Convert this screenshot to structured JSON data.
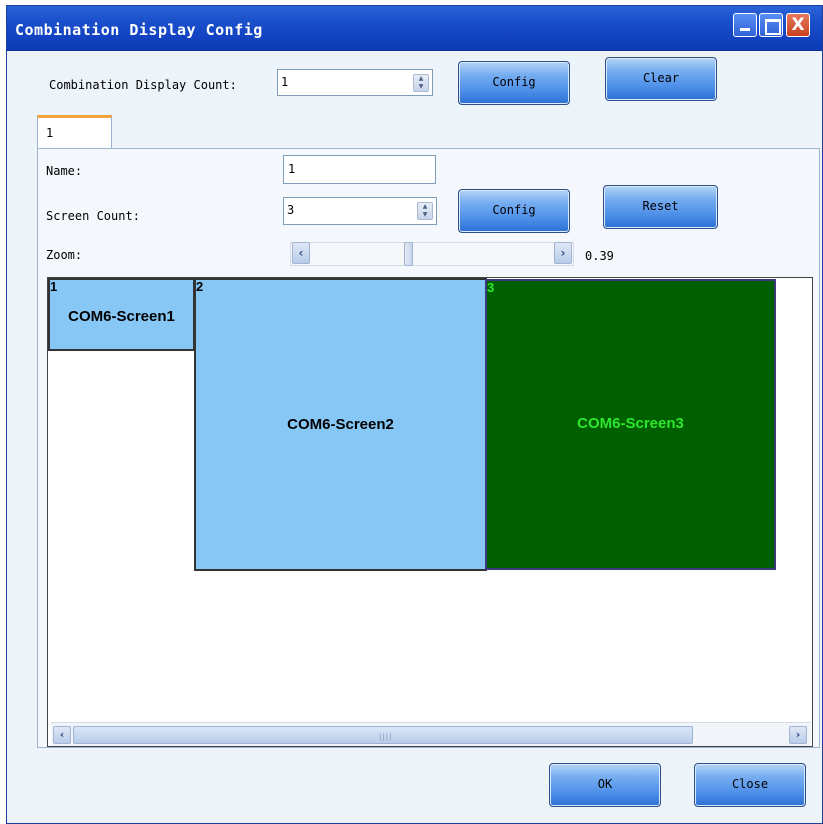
{
  "window": {
    "title": "Combination Display Config",
    "close_glyph": "X"
  },
  "top": {
    "count_label": "Combination Display Count:",
    "count_value": "1",
    "config_label": "Config",
    "clear_label": "Clear"
  },
  "tab": {
    "label": "1"
  },
  "form": {
    "name_label": "Name:",
    "name_value": "1",
    "screen_count_label": "Screen Count:",
    "screen_count_value": "3",
    "config_label": "Config",
    "reset_label": "Reset",
    "zoom_label": "Zoom:",
    "zoom_value": "0.39"
  },
  "screens": [
    {
      "num": "1",
      "name": "COM6-Screen1",
      "fill": "#87c7f5",
      "text_color": "#000000"
    },
    {
      "num": "2",
      "name": "COM6-Screen2",
      "fill": "#87c7f5",
      "text_color": "#000000"
    },
    {
      "num": "3",
      "name": "COM6-Screen3",
      "fill": "#006000",
      "text_color": "#2ee62e"
    }
  ],
  "footer": {
    "ok_label": "OK",
    "close_label": "Close"
  },
  "icons": {
    "spin": "spin-arrows-icon",
    "left": "chevron-left-icon",
    "right": "chevron-right-icon",
    "grip": "scroll-grip-icon"
  }
}
